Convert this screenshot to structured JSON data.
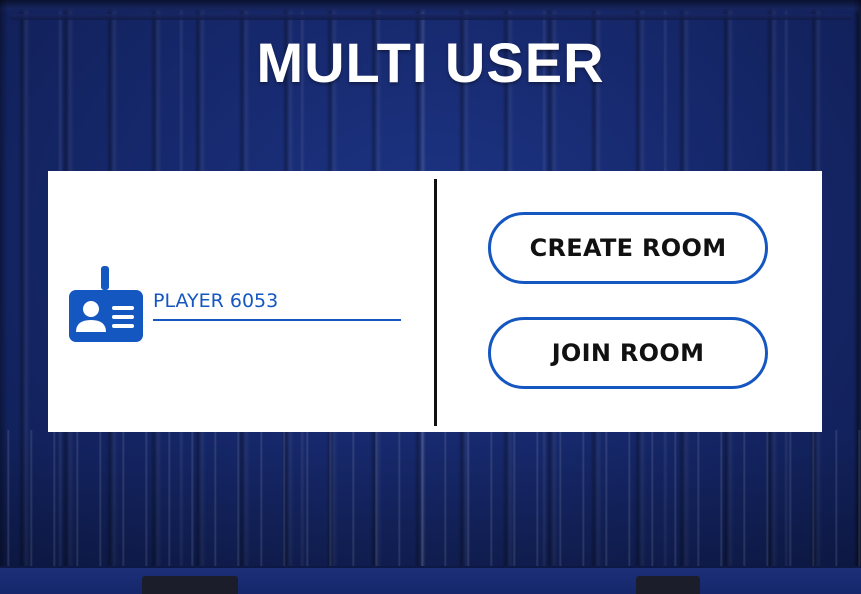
{
  "screen": {
    "title": "MULTI USER"
  },
  "player": {
    "name": "PLAYER 6053",
    "icon": "id-badge-icon"
  },
  "actions": {
    "create_room_label": "CREATE ROOM",
    "join_room_label": "JOIN ROOM"
  },
  "colors": {
    "accent": "#1557c0",
    "panel": "#ffffff",
    "background": "#17296e",
    "button_text": "#111111",
    "title_text": "#ffffff"
  }
}
